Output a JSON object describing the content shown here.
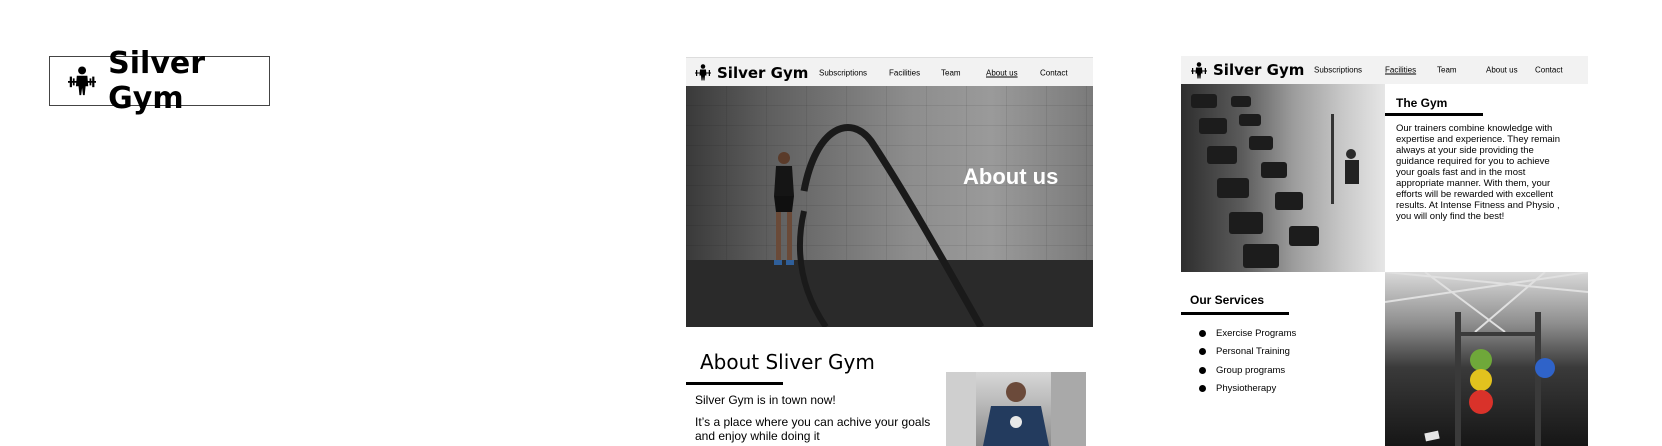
{
  "logo": {
    "text": "Silver Gym",
    "icon": "weightlifter-icon"
  },
  "mockup_about": {
    "nav": {
      "brand": "Silver Gym",
      "items": [
        "Subscriptions",
        "Facilities",
        "Team",
        "About us",
        "Contact"
      ],
      "active": "About us"
    },
    "hero": {
      "title": "About us",
      "image": "battle-rope-athlete-photo"
    },
    "about": {
      "title": "About Sliver Gym",
      "paragraph1": "Silver Gym is in town now!",
      "paragraph2": "It’s a place where you can achive your goals and enjoy while doing it"
    },
    "thumbnail": "trainer-photo"
  },
  "mockup_facilities": {
    "nav": {
      "brand": "Silver Gym",
      "items": [
        "Subscriptions",
        "Facilities",
        "Team",
        "About us",
        "Contact"
      ],
      "active": "Facilities"
    },
    "gym": {
      "title": "The Gym",
      "text": "Our trainers combine knowledge with expertise and experience. They remain always at your side providing the guidance required for you to achieve your goals fast and in the most appropriate manner. With them, your efforts will be rewarded with excellent results. At Intense Fitness and Physio , you will only find the best!"
    },
    "services": {
      "title": "Our Services",
      "items": [
        "Exercise Programs",
        "Personal Training",
        "Group programs",
        "Physiotherapy"
      ]
    },
    "images": [
      "dumbbell-rack-photo",
      "squat-rack-plates-photo"
    ]
  },
  "colors": {
    "nav_bg": "#f2f2f2",
    "text": "#000000",
    "hero_text": "#ffffff"
  }
}
